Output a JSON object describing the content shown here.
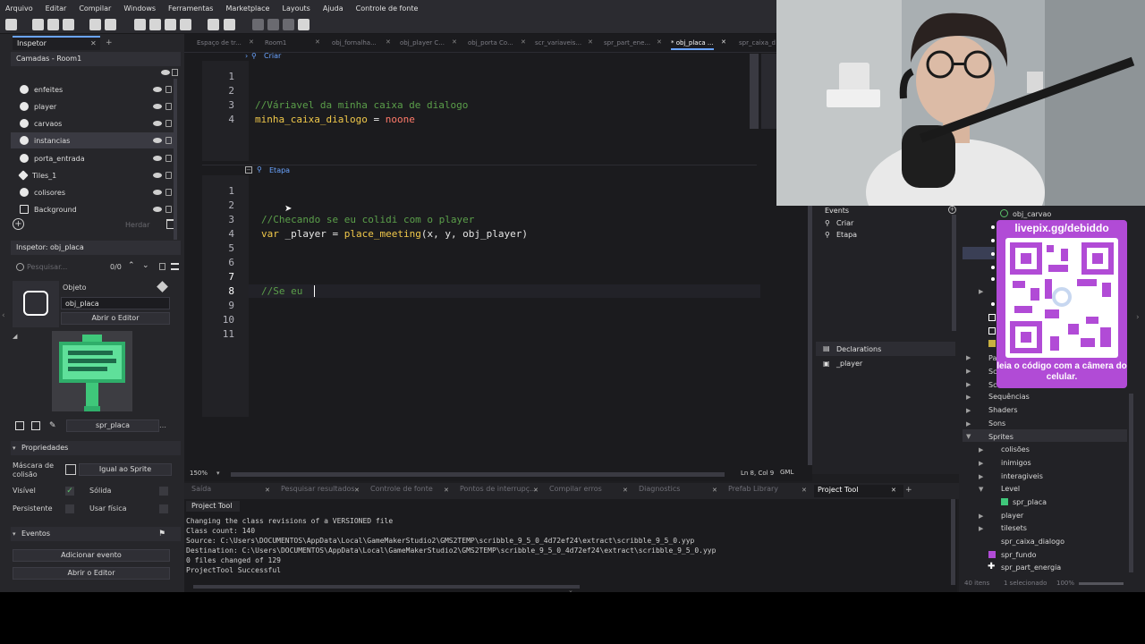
{
  "menu": [
    "Arquivo",
    "Editar",
    "Compilar",
    "Windows",
    "Ferramentas",
    "Marketplace",
    "Layouts",
    "Ajuda",
    "Controle de fonte"
  ],
  "left_panel": {
    "tab": "Inspetor",
    "layers_header": "Camadas - Room1",
    "layers": [
      "enfeites",
      "player",
      "carvaos",
      "instancias",
      "porta_entrada",
      "Tiles_1",
      "colisores",
      "Background"
    ],
    "herdar": "Herdar",
    "inspector_header": "Inspetor: obj_placa",
    "search_placeholder": "Pesquisar...",
    "search_count": "0/0",
    "objeto_label": "Objeto",
    "object_name": "obj_placa",
    "open_editor": "Abrir o Editor",
    "sprite_name": "spr_placa",
    "properties_header": "Propriedades",
    "mask_label": "Máscara de colisão",
    "mask_value": "Igual ao Sprite",
    "visible_label": "Visível",
    "solid_label": "Sólida",
    "persistent_label": "Persistente",
    "physics_label": "Usar física",
    "events_header": "Eventos",
    "add_event": "Adicionar evento",
    "open_editor2": "Abrir o Editor"
  },
  "file_tabs": [
    "Espaço de tr...",
    "Room1",
    "obj_fornalha...",
    "obj_player C...",
    "obj_porta Co...",
    "scr_variaveis...",
    "spr_part_ene...",
    "* obj_placa ...",
    "spr_caixa_d"
  ],
  "code": {
    "event1": "Criar",
    "event1_lines": [
      "1",
      "2",
      "3",
      "4"
    ],
    "l3": "//Váriavel da minha caixa de dialogo",
    "l4_id": "minha_caixa_dialogo",
    "l4_op": " = ",
    "l4_val": "noone",
    "event2": "Etapa",
    "event2_lines": [
      "1",
      "2",
      "3",
      "4",
      "5",
      "6",
      "7",
      "8",
      "9",
      "10",
      "11"
    ],
    "e2_l3": "//Checando se eu colidi com o player",
    "e2_l4_kw": "var",
    "e2_l4_id": " _player = ",
    "e2_l4_fn": "place_meeting",
    "e2_l4_args": "(x, y, obj_player)",
    "e2_l8": "//Se eu "
  },
  "editor_status": {
    "zoom": "150%",
    "position": "Ln 8, Col 9",
    "lang": "GML"
  },
  "output_tabs": [
    "Saída",
    "Pesquisar resultados",
    "Controle de fonte",
    "Pontos de interrupç...",
    "Compilar erros",
    "Diagnostics",
    "Prefab Library",
    "Project Tool"
  ],
  "output_header": "Project Tool",
  "output_lines": [
    "Changing the class revisions of a VERSIONED file",
    "Class count: 140",
    "Source: C:\\Users\\DOCUMENTOS\\AppData\\Local\\GameMakerStudio2\\GMS2TEMP\\scribble_9_5_0_4d72ef24\\extract\\scribble_9_5_0.yyp",
    "Destination: C:\\Users\\DOCUMENTOS\\AppData\\Local\\GameMakerStudio2\\GMS2TEMP\\scribble_9_5_0_4d72ef24\\extract\\scribble_9_5_0.yyp",
    "0 files changed of 129",
    "ProjectTool Successful"
  ],
  "events_panel": {
    "header": "Events",
    "items": [
      "Criar",
      "Etapa"
    ],
    "declarations": "Declarations",
    "decl_items": [
      "_player"
    ]
  },
  "assets": {
    "top_item": "obj_carvao",
    "items": [
      "Sequências",
      "Shaders",
      "Sons",
      "Sprites",
      "colisões",
      "inimigos",
      "interagiveis",
      "Level",
      "spr_placa",
      "player",
      "tilesets",
      "spr_caixa_dialogo",
      "spr_fundo",
      "spr_part_energia"
    ],
    "partial": [
      "Pa",
      "Sc",
      "Sc"
    ],
    "footer_items": "40 itens",
    "footer_sel": "1 selecionado",
    "footer_zoom": "100%"
  },
  "overlay": {
    "title": "livepix.gg/debiddo",
    "caption": "leia o código com a câmera do celular."
  },
  "colors": {
    "accent": "#6aa4ff",
    "overlay_purple": "#b14bd6",
    "comment": "#5b9f4a",
    "keyword": "#f0c84a",
    "constant": "#ff7a6a"
  }
}
